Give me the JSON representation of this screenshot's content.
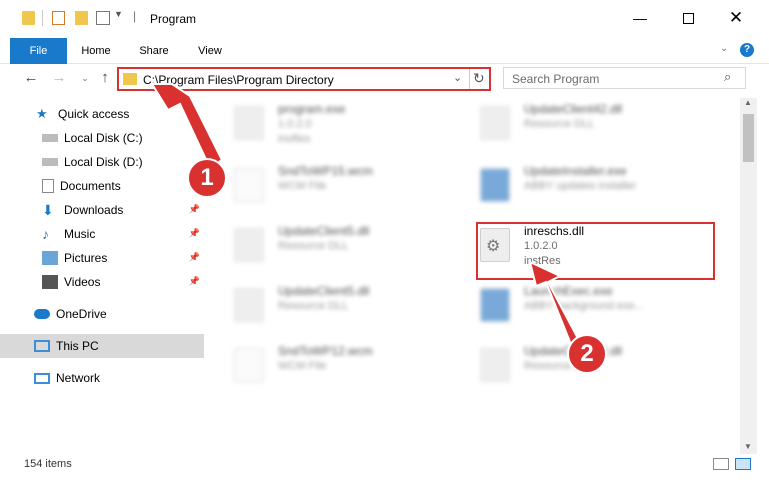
{
  "window": {
    "title": "Program"
  },
  "ribbon": {
    "tabs": [
      "File",
      "Home",
      "Share",
      "View"
    ]
  },
  "nav": {
    "address": "C:\\Program Files\\Program Directory",
    "search_placeholder": "Search Program"
  },
  "sidebar": {
    "items": [
      {
        "label": "Quick access",
        "icon": "star-icon"
      },
      {
        "label": "Local Disk (C:)",
        "icon": "drive-icon"
      },
      {
        "label": "Local Disk (D:)",
        "icon": "drive-icon"
      },
      {
        "label": "Documents",
        "icon": "documents-icon"
      },
      {
        "label": "Downloads",
        "icon": "download-icon"
      },
      {
        "label": "Music",
        "icon": "music-icon"
      },
      {
        "label": "Pictures",
        "icon": "pictures-icon"
      },
      {
        "label": "Videos",
        "icon": "videos-icon"
      },
      {
        "label": "OneDrive",
        "icon": "cloud-icon"
      },
      {
        "label": "This PC",
        "icon": "computer-icon"
      },
      {
        "label": "Network",
        "icon": "network-icon"
      }
    ]
  },
  "files": [
    {
      "name": "program.exe",
      "line2": "1.0.2.0",
      "line3": "inoftes"
    },
    {
      "name": "UpdateClient42.dll",
      "line2": "Resource DLL",
      "line3": ""
    },
    {
      "name": "SndToWP15.wcm",
      "line2": "WCM File",
      "line3": ""
    },
    {
      "name": "UpdateInstaller.exe",
      "line2": "ABBY updates installer",
      "line3": ""
    },
    {
      "name": "UpdateClient5.dll",
      "line2": "Resource DLL",
      "line3": ""
    },
    {
      "name": "inreschs.dll",
      "line2": "1.0.2.0",
      "line3": "instRes"
    },
    {
      "name": "UpdateClient5.dll",
      "line2": "Resource DLL",
      "line3": ""
    },
    {
      "name": "LaunchExec.exe",
      "line2": "ABBY background exe...",
      "line3": ""
    },
    {
      "name": "SndToWP12.wcm",
      "line2": "WCM File",
      "line3": ""
    },
    {
      "name": "UpdateClient42.dll",
      "line2": "Resource DLL",
      "line3": ""
    }
  ],
  "status": {
    "count": "154 items"
  },
  "annotations": {
    "badge1": "1",
    "badge2": "2"
  },
  "colors": {
    "accent": "#1979ca",
    "annotation": "#d93030"
  }
}
